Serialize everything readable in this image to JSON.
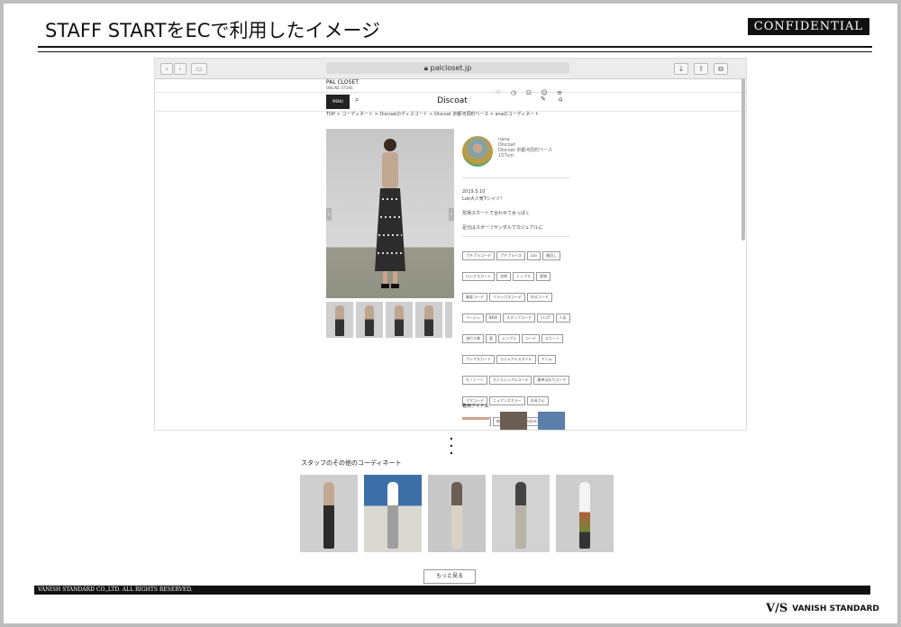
{
  "slide": {
    "title": "STAFF STARTをECで利用したイメージ",
    "confidential": "CONFIDENTIAL",
    "footer": "VANISH STANDARD CO.,LTD. ALL RIGHTS RESERVED.",
    "brand_logo": "VANISH STANDARD"
  },
  "browser": {
    "url": "palcloset.jp",
    "site": {
      "logo": "PAL CLOSET",
      "logo_sub": "ONLINE STORE",
      "brand": "Discoat",
      "menu_label": "MENU",
      "breadcrumb": "TOP > コーディネート > Discoatのディスコート > Discoat 京都河原町ベース > anaのコーディネート",
      "profile": {
        "name": "nana",
        "shop": "Discoat",
        "store": "Discoat 京都河原町ベース",
        "height": "157cm"
      },
      "post": {
        "date": "2019.5.10",
        "lines": [
          "Loo大人気Tシャツ！",
          "花柄スカートで合わせて女っぽく",
          "足元はスポーツサンダルでカジュアルに"
        ]
      },
      "tags": [
        "プチプラコーデ",
        "プチプライス",
        "Loo",
        "着回し",
        "ロングスカート",
        "花柄",
        "トップス",
        "夏物",
        "春夏コーデ",
        "リラックスコーデ",
        "ゆるコーデ",
        "ベージュ",
        "NEW",
        "スタッフコーデ",
        "ロゴT",
        "人気",
        "流行り物",
        "夏",
        "シンプル",
        "コーデ",
        "スカート",
        "フレアスカート",
        "カジュアルスタイル",
        "デニム",
        "モノトーン",
        "大人カジュアルコーデ",
        "簡単はおりコーデ",
        "ママコーデ",
        "ニュアンスカラー",
        "お母さん",
        "着回しコーデ",
        "無地Tコーデ",
        "お好みコーデ",
        "ハッコウド"
      ],
      "items_heading": "着用アイテム"
    }
  },
  "other": {
    "heading": "スタッフのその他のコーディネート",
    "more_button": "もっと見る"
  },
  "colors": {
    "accent": "#111111",
    "bg": "#bdbdbd"
  }
}
